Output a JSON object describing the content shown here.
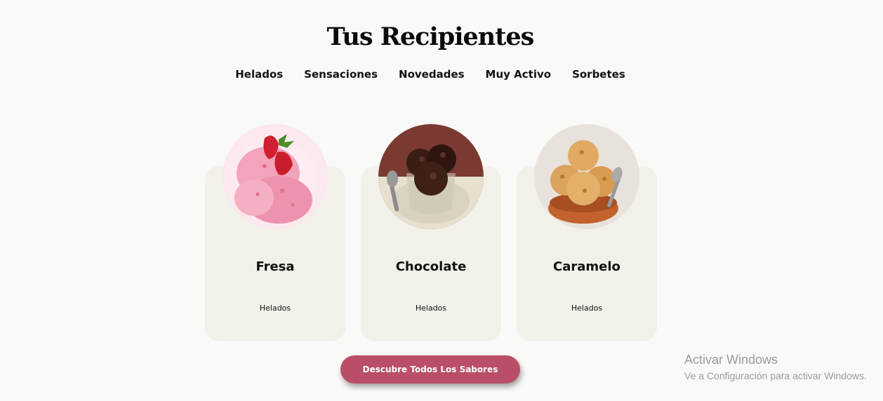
{
  "header": {
    "title": "Tus Recipientes"
  },
  "nav": {
    "items": [
      "Helados",
      "Sensaciones",
      "Novedades",
      "Muy Activo",
      "Sorbetes"
    ]
  },
  "cards": [
    {
      "title": "Fresa",
      "subtitle": "Helados",
      "image": "strawberry-ice-cream"
    },
    {
      "title": "Chocolate",
      "subtitle": "Helados",
      "image": "chocolate-ice-cream"
    },
    {
      "title": "Caramelo",
      "subtitle": "Helados",
      "image": "caramel-ice-cream"
    }
  ],
  "cta": {
    "label": "Descubre Todos Los Sabores",
    "color": "#b94e66"
  },
  "watermark": {
    "title": "Activar Windows",
    "subtitle": "Ve a Configuración para activar Windows."
  }
}
